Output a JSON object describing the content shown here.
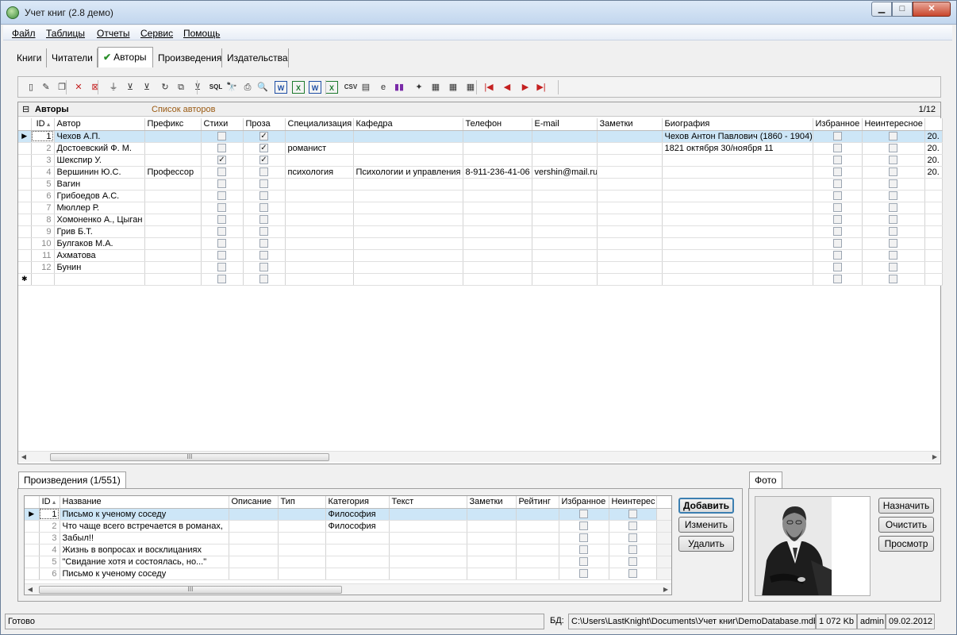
{
  "window": {
    "title": "Учет книг (2.8 демо)",
    "min_glyph": "▁",
    "max_glyph": "□",
    "close_glyph": "✕"
  },
  "menu": [
    "Файл",
    "Таблицы",
    "Отчеты",
    "Сервис",
    "Помощь"
  ],
  "tabs": [
    {
      "label": "Книги",
      "active": false
    },
    {
      "label": "Читатели",
      "active": false
    },
    {
      "label": "Авторы",
      "active": true,
      "check": "✔"
    },
    {
      "label": "Произведения",
      "active": false
    },
    {
      "label": "Издательства",
      "active": false
    }
  ],
  "toolbar": {
    "icons": [
      "new-record-icon",
      "edit-icon",
      "copy-icon",
      "delete-icon",
      "delete-all-icon",
      "filter-icon",
      "clear-filter-icon",
      "clear-filters-icon",
      "refresh-icon",
      "tree-icon",
      "filter-by-icon",
      "sql-icon",
      "find-icon",
      "print-icon",
      "preview-icon",
      "word-export-icon",
      "excel-export-icon",
      "word-icon",
      "excel-icon",
      "csv-export-icon",
      "text-export-icon",
      "html-export-icon",
      "chart-icon",
      "columns-icon",
      "settings-icon",
      "properties-icon",
      "table-settings-icon",
      "first-record-icon",
      "prev-record-icon",
      "next-record-icon",
      "last-record-icon"
    ],
    "glyphs": [
      "▯",
      "✎",
      "❐",
      "✕",
      "⊠",
      "⏚",
      "⊻",
      "⊻",
      "↻",
      "⧉",
      "⊻",
      "SQL",
      "🔭",
      "⎙",
      "🔍",
      "W",
      "X",
      "W",
      "X",
      "CSV",
      "▤",
      "e",
      "▮▮",
      "✦",
      "▦",
      "▦",
      "▦",
      "|◀",
      "◀",
      "▶",
      "▶|"
    ],
    "sql_label": "SQL"
  },
  "authors": {
    "title": "Авторы",
    "subtitle": "Список авторов",
    "position": "1/12",
    "collapse_glyph": "⊟",
    "columns": [
      "ID",
      "Автор",
      "Префикс",
      "Стихи",
      "Проза",
      "Специализация",
      "Кафедра",
      "Телефон",
      "E-mail",
      "Заметки",
      "Биография",
      "Избранное",
      "Неинтересное"
    ],
    "sort_glyph": "▲",
    "current_marker": "▶",
    "new_row_marker": "✱",
    "check_glyph": "✓",
    "scroll_thumb": "III",
    "scroll_left": "◀",
    "scroll_right": "▶",
    "rows": [
      {
        "id": "1",
        "author": "Чехов А.П.",
        "prefix": "",
        "poems": false,
        "prose": true,
        "spec": "",
        "dept": "",
        "phone": "",
        "email": "",
        "notes": "",
        "bio": "Чехов Антон Павлович (1860 - 1904),",
        "fav": false,
        "notint": false,
        "extra": "20."
      },
      {
        "id": "2",
        "author": "Достоевский Ф. М.",
        "prefix": "",
        "poems": false,
        "prose": true,
        "spec": "романист",
        "dept": "",
        "phone": "",
        "email": "",
        "notes": "",
        "bio": "1821 октября 30/ноября 11",
        "fav": false,
        "notint": false,
        "extra": "20."
      },
      {
        "id": "3",
        "author": "Шекспир У.",
        "prefix": "",
        "poems": true,
        "prose": true,
        "spec": "",
        "dept": "",
        "phone": "",
        "email": "",
        "notes": "",
        "bio": "",
        "fav": false,
        "notint": false,
        "extra": "20."
      },
      {
        "id": "4",
        "author": "Вершинин Ю.С.",
        "prefix": "Профессор",
        "poems": false,
        "prose": false,
        "spec": "психология",
        "dept": "Психологии и управления",
        "phone": "8-911-236-41-06",
        "email": "vershin@mail.ru",
        "notes": "",
        "bio": "",
        "fav": false,
        "notint": false,
        "extra": "20."
      },
      {
        "id": "5",
        "author": "Вагин",
        "prefix": "",
        "poems": false,
        "prose": false,
        "spec": "",
        "dept": "",
        "phone": "",
        "email": "",
        "notes": "",
        "bio": "",
        "fav": false,
        "notint": false,
        "extra": ""
      },
      {
        "id": "6",
        "author": "Грибоедов А.С.",
        "prefix": "",
        "poems": false,
        "prose": false,
        "spec": "",
        "dept": "",
        "phone": "",
        "email": "",
        "notes": "",
        "bio": "",
        "fav": false,
        "notint": false,
        "extra": ""
      },
      {
        "id": "7",
        "author": "Мюллер Р.",
        "prefix": "",
        "poems": false,
        "prose": false,
        "spec": "",
        "dept": "",
        "phone": "",
        "email": "",
        "notes": "",
        "bio": "",
        "fav": false,
        "notint": false,
        "extra": ""
      },
      {
        "id": "8",
        "author": "Хомоненко А., Цыган",
        "prefix": "",
        "poems": false,
        "prose": false,
        "spec": "",
        "dept": "",
        "phone": "",
        "email": "",
        "notes": "",
        "bio": "",
        "fav": false,
        "notint": false,
        "extra": ""
      },
      {
        "id": "9",
        "author": "Грив Б.Т.",
        "prefix": "",
        "poems": false,
        "prose": false,
        "spec": "",
        "dept": "",
        "phone": "",
        "email": "",
        "notes": "",
        "bio": "",
        "fav": false,
        "notint": false,
        "extra": ""
      },
      {
        "id": "10",
        "author": "Булгаков М.А.",
        "prefix": "",
        "poems": false,
        "prose": false,
        "spec": "",
        "dept": "",
        "phone": "",
        "email": "",
        "notes": "",
        "bio": "",
        "fav": false,
        "notint": false,
        "extra": ""
      },
      {
        "id": "11",
        "author": "Ахматова",
        "prefix": "",
        "poems": false,
        "prose": false,
        "spec": "",
        "dept": "",
        "phone": "",
        "email": "",
        "notes": "",
        "bio": "",
        "fav": false,
        "notint": false,
        "extra": ""
      },
      {
        "id": "12",
        "author": "Бунин",
        "prefix": "",
        "poems": false,
        "prose": false,
        "spec": "",
        "dept": "",
        "phone": "",
        "email": "",
        "notes": "",
        "bio": "",
        "fav": false,
        "notint": false,
        "extra": ""
      }
    ]
  },
  "works": {
    "tab_label": "Произведения (1/551)",
    "columns": [
      "ID",
      "Название",
      "Описание",
      "Тип",
      "Категория",
      "Текст",
      "Заметки",
      "Рейтинг",
      "Избранное",
      "Неинтерес"
    ],
    "rows": [
      {
        "id": "1",
        "name": "Письмо к ученому соседу",
        "category": "Философия"
      },
      {
        "id": "2",
        "name": "Что чаще всего встречается в романах,",
        "category": "Философия"
      },
      {
        "id": "3",
        "name": "Забыл!!",
        "category": ""
      },
      {
        "id": "4",
        "name": "Жизнь в вопросах и восклицаниях",
        "category": ""
      },
      {
        "id": "5",
        "name": "\"Свидание хотя и состоялась, но...\"",
        "category": ""
      },
      {
        "id": "6",
        "name": "Письмо к ученому соседу",
        "category": ""
      }
    ],
    "buttons": {
      "add": "Добавить",
      "edit": "Изменить",
      "delete": "Удалить"
    }
  },
  "photo": {
    "tab_label": "Фото",
    "buttons": {
      "assign": "Назначить",
      "clear": "Очистить",
      "view": "Просмотр"
    }
  },
  "status": {
    "text": "Готово",
    "db_label": "БД:",
    "db_path": "C:\\Users\\LastKnight\\Documents\\Учет книг\\DemoDatabase.mdb",
    "size": "1 072 Kb",
    "user": "admin",
    "date": "09.02.2012"
  }
}
